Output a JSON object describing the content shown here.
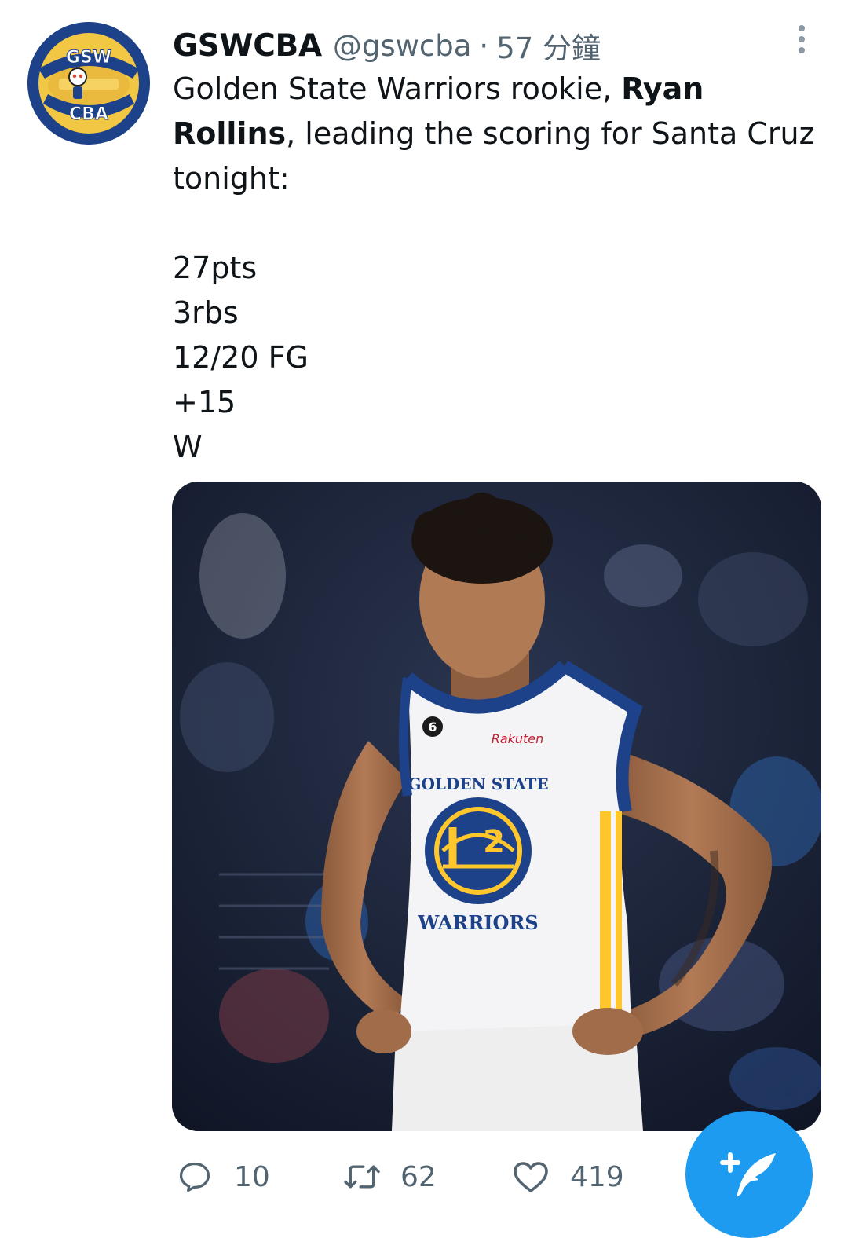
{
  "user": {
    "display_name": "GSWCBA",
    "handle": "@gswcba",
    "separator": "·",
    "timestamp": "57 分鐘",
    "avatar_top_text": "GSW",
    "avatar_bottom_text": "CBA"
  },
  "tweet": {
    "text_part1": "Golden State Warriors rookie, ",
    "text_bold1": "Ryan",
    "text_bold2": "Rollins",
    "text_part2": ", leading the scoring for Santa Cruz",
    "text_part3": "tonight:",
    "stat_lines": [
      "27pts",
      "3rbs",
      "12/20 FG",
      "+15",
      "W"
    ]
  },
  "media": {
    "jersey_sponsor": "Rakuten",
    "jersey_top_text": "GOLDEN STATE",
    "jersey_bottom_text": "WARRIORS",
    "jersey_number": "2",
    "patch_number": "6"
  },
  "actions": {
    "reply_count": "10",
    "retweet_count": "62",
    "like_count": "419"
  },
  "colors": {
    "accent": "#1d9bf0",
    "secondary_text": "#536471",
    "warriors_blue": "#1d428a",
    "warriors_gold": "#ffc72c"
  },
  "icons": [
    "reply-icon",
    "retweet-icon",
    "heart-icon",
    "compose-tweet-icon",
    "more-options-icon"
  ]
}
